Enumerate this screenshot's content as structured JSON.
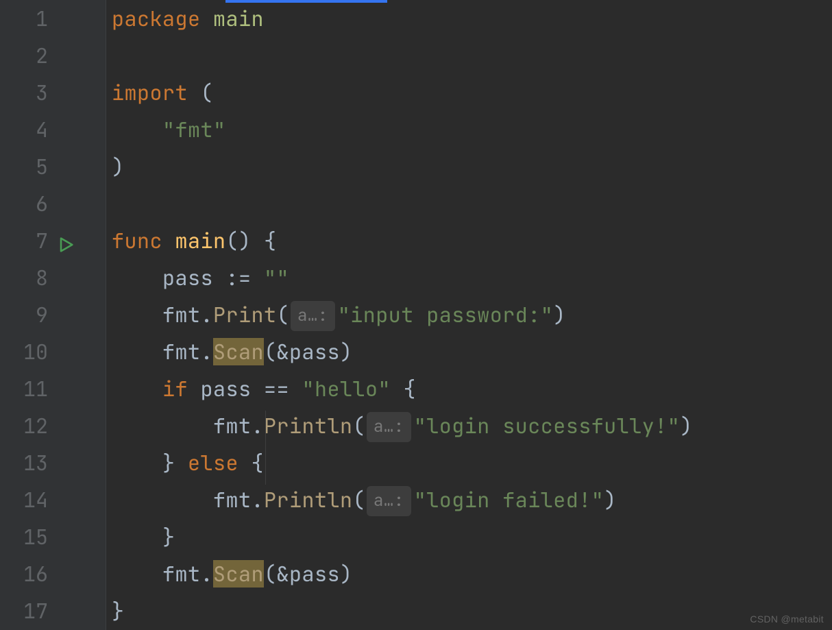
{
  "watermark": "CSDN @metabit",
  "line_numbers": [
    "1",
    "2",
    "3",
    "4",
    "5",
    "6",
    "7",
    "8",
    "9",
    "10",
    "11",
    "12",
    "13",
    "14",
    "15",
    "16",
    "17"
  ],
  "code": {
    "l1": {
      "kw": "package",
      "name": "main"
    },
    "l3": {
      "kw": "import",
      "paren": "("
    },
    "l4": {
      "str": "\"fmt\""
    },
    "l5": {
      "paren": ")"
    },
    "l7": {
      "kw": "func",
      "name": "main",
      "parens": "()",
      "brace": "{"
    },
    "l8": {
      "ident": "pass",
      "op": ":=",
      "str": "\"\""
    },
    "l9": {
      "pkg": "fmt",
      "dot": ".",
      "fn": "Print",
      "open": "(",
      "hint": "a…:",
      "str": "\"input password:\"",
      "close": ")"
    },
    "l10": {
      "pkg": "fmt",
      "dot": ".",
      "fn": "Scan",
      "open": "(",
      "arg": "&pass",
      "close": ")"
    },
    "l11": {
      "kw": "if",
      "ident": "pass",
      "op": "==",
      "str": "\"hello\"",
      "brace": "{"
    },
    "l12": {
      "pkg": "fmt",
      "dot": ".",
      "fn": "Println",
      "open": "(",
      "hint": "a…:",
      "str": "\"login successfully!\"",
      "close": ")"
    },
    "l13": {
      "close_brace": "}",
      "kw": "else",
      "open_brace": "{"
    },
    "l14": {
      "pkg": "fmt",
      "dot": ".",
      "fn": "Println",
      "open": "(",
      "hint": "a…:",
      "str": "\"login failed!\"",
      "close": ")"
    },
    "l15": {
      "brace": "}"
    },
    "l16": {
      "pkg": "fmt",
      "dot": ".",
      "fn": "Scan",
      "open": "(",
      "arg": "&pass",
      "close": ")"
    },
    "l17": {
      "brace": "}"
    }
  }
}
